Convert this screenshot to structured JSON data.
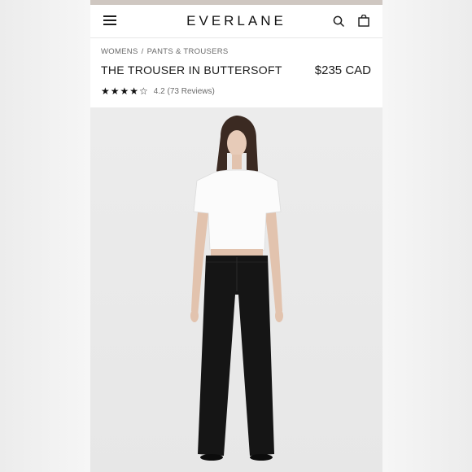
{
  "header": {
    "brand": "EVERLANE",
    "icons": {
      "menu": "hamburger-menu-icon",
      "search": "search-icon",
      "cart": "shopping-bag-icon"
    }
  },
  "breadcrumb": {
    "level1": "WOMENS",
    "separator": "/",
    "level2": "PANTS & TROUSERS"
  },
  "product": {
    "title": "THE TROUSER IN BUTTERSOFT",
    "price": "$235 CAD",
    "rating": {
      "stars_display": "★★★★☆",
      "value": 4.2,
      "value_label": "4.2",
      "reviews_label": "(73 Reviews)"
    },
    "image": {
      "description": "model-white-tee-black-wide-leg-trousers"
    }
  },
  "colors": {
    "status_strip": "#cfc7c1",
    "text": "#1b1b1b",
    "muted": "#6a6a6a"
  }
}
